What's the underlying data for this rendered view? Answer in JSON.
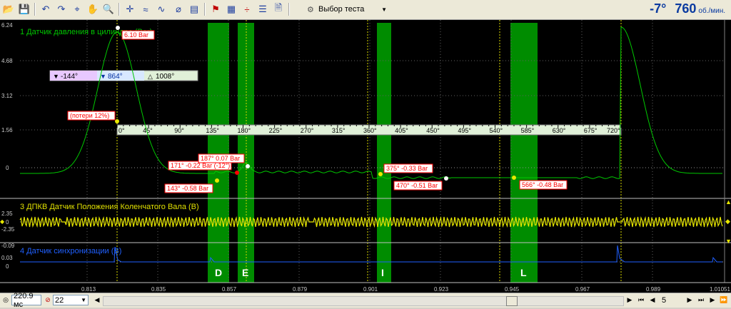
{
  "toolbar": {
    "test_select": "Выбор теста",
    "rpm_angle": "-7°",
    "rpm_value": "760",
    "rpm_unit": "об./мин."
  },
  "channels": {
    "ch1_label": "1 Датчик давления в цилиндре (Bar)",
    "ch3_label": "3 ДПКВ Датчик Положения Коленчатого Вала (B)",
    "ch4_label": "4 Датчик синхронизации (B)"
  },
  "y_axis": {
    "ch1": [
      "6.24",
      "4.68",
      "3.12",
      "1.56",
      "0"
    ],
    "ch3": [
      "2.35",
      "0",
      "-2.35"
    ],
    "ch4": [
      "-0.09",
      "0.03",
      "0"
    ]
  },
  "x_axis": [
    "0.813",
    "0.835",
    "0.857",
    "0.879",
    "0.901",
    "0.923",
    "0.945",
    "0.967",
    "0.989",
    "1.01051"
  ],
  "zones": [
    "D",
    "E",
    "I",
    "L"
  ],
  "angle_ruler": {
    "ticks": [
      "0°",
      "45°",
      "90°",
      "135°",
      "180°",
      "225°",
      "270°",
      "315°",
      "360°",
      "405°",
      "450°",
      "495°",
      "540°",
      "585°",
      "630°",
      "675°",
      "720°"
    ]
  },
  "cursor_box": {
    "c1": "-144°",
    "c2": "864°",
    "delta": "1008°"
  },
  "markers": {
    "peak": "6.10 Bar",
    "loss": "(потери 12%)",
    "m187": "187° 0.07 Bar",
    "m171": "171° -0.22 Bar (-12°)",
    "m143": "143° -0.58 Bar",
    "m375": "375° -0.33 Bar",
    "m470": "470° -0.51 Bar",
    "m566": "566° -0.48 Bar"
  },
  "status": {
    "timebase": "220.9 мс",
    "count": "22",
    "page": "5"
  },
  "colors": {
    "trace_pressure": "#00c800",
    "trace_crank": "#e8e800",
    "trace_sync": "#2060ff",
    "zone": "#008c00",
    "label_red": "#ff0000"
  }
}
